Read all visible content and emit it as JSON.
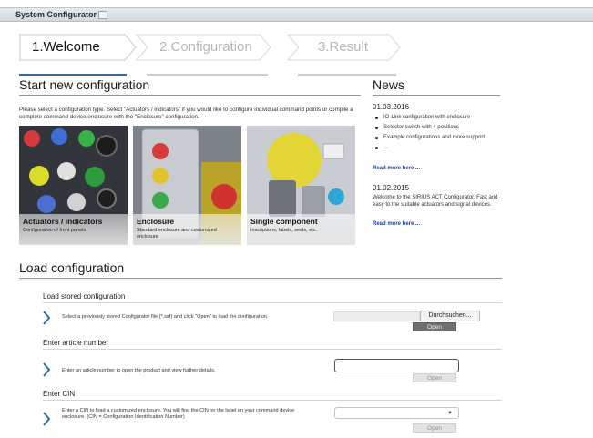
{
  "window": {
    "title": "System Configurator"
  },
  "steps": [
    {
      "label": "1.Welcome",
      "state": "active"
    },
    {
      "label": "2.Configuration",
      "state": "inactive"
    },
    {
      "label": "3.Result",
      "state": "inactive"
    }
  ],
  "start": {
    "heading": "Start new configuration",
    "intro": "Please select a configuration type. Select \"Actuators / indicators\" if you would like to configure individual command points or compile a complete command device enclosure with the \"Enclosure\" configuration.",
    "tiles": [
      {
        "title": "Actuators / indicators",
        "subtitle": "Configuration of front panels"
      },
      {
        "title": "Enclosure",
        "subtitle": "Standard enclosure and customized enclosure"
      },
      {
        "title": "Single component",
        "subtitle": "Inscriptions, labels, seals, etc."
      }
    ]
  },
  "news": {
    "heading": "News",
    "items": [
      {
        "date": "01.03.2016",
        "bullets": [
          "IO-Link configuration with enclosure",
          "Selector switch with 4 positions",
          "Example configurations and more support",
          "..."
        ],
        "more": "Read more here ..."
      },
      {
        "date": "01.02.2015",
        "text": "Welcome to the SIRIUS ACT Configurator. Fast and easy to the suitable actuators and signal devices.",
        "more": "Read more here ..."
      }
    ]
  },
  "load": {
    "heading": "Load configuration",
    "stored": {
      "heading": "Load stored configuration",
      "desc": "Select a previously stored Configurator file (*.ssf) and click \"Open\" to load the configuration.",
      "browse": "Durchsuchen...",
      "open": "Open"
    },
    "article": {
      "heading": "Enter article number",
      "desc": "Enter an article number to open the product and view further details.",
      "value": "",
      "open": "Open"
    },
    "cin": {
      "heading": "Enter CIN",
      "desc": "Enter a CIN to load a customized enclosure. You will find the CIN on the label on your command device enclosure. (CIN = Configuration Identification Number)",
      "selected": "",
      "open": "Open"
    }
  },
  "colors": {
    "accent": "#2d6fa0",
    "step_inactive_bar": "#c9cdd1",
    "link": "#1f3e9a"
  }
}
